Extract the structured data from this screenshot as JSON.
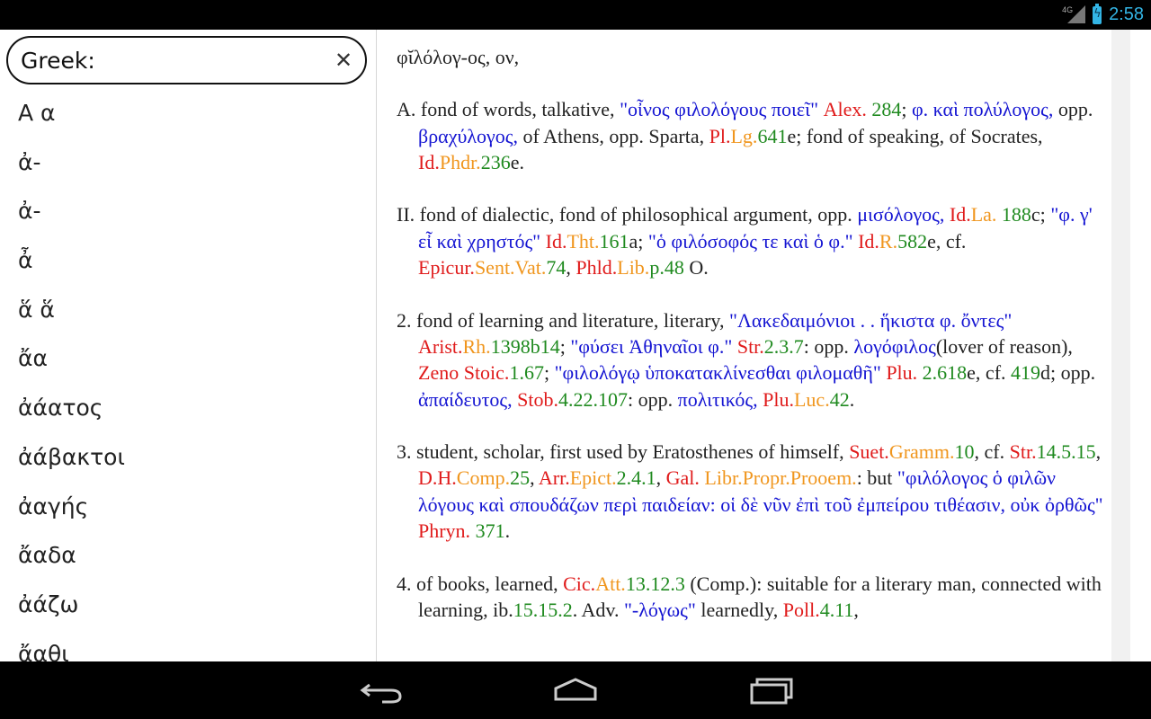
{
  "status": {
    "network": "4G",
    "time": "2:58"
  },
  "search": {
    "value": "Greek:",
    "placeholder": "Greek:"
  },
  "words": [
    "Α α",
    "ἀ-",
    "ἀ-",
    "ἆ",
    "ἅ ἅ",
    "ἄα",
    "ἀάατος",
    "ἀάβακτοι",
    "ἀαγής",
    "ἄαδα",
    "ἀάζω",
    "ἄαθι"
  ],
  "entry": {
    "title": "φῐλόλογ-ος, ον,",
    "senses": [
      {
        "label": "A.",
        "parts": [
          {
            "t": " fond of words, talkative, ",
            "c": ""
          },
          {
            "t": "\"οἶνος φιλολόγους ποιεῖ\"",
            "c": "gk"
          },
          {
            "t": " ",
            "c": ""
          },
          {
            "t": "Alex.",
            "c": "ref-a"
          },
          {
            "t": " ",
            "c": ""
          },
          {
            "t": "284",
            "c": "ref-c"
          },
          {
            "t": "; ",
            "c": ""
          },
          {
            "t": "φ. καὶ πολύλογος,",
            "c": "gk"
          },
          {
            "t": " opp. ",
            "c": ""
          },
          {
            "t": "βραχύλογος,",
            "c": "gk"
          },
          {
            "t": " of Athens, opp. Sparta, ",
            "c": ""
          },
          {
            "t": "Pl.",
            "c": "ref-a"
          },
          {
            "t": "Lg.",
            "c": "ref-b"
          },
          {
            "t": "641",
            "c": "ref-c"
          },
          {
            "t": "e; fond of speaking, of Socrates, ",
            "c": ""
          },
          {
            "t": "Id.",
            "c": "ref-a"
          },
          {
            "t": "Phdr.",
            "c": "ref-b"
          },
          {
            "t": "236",
            "c": "ref-c"
          },
          {
            "t": "e.",
            "c": ""
          }
        ]
      },
      {
        "label": "II.",
        "parts": [
          {
            "t": " fond of dialectic, fond of philosophical argument, opp. ",
            "c": ""
          },
          {
            "t": "μισόλογος,",
            "c": "gk"
          },
          {
            "t": " ",
            "c": ""
          },
          {
            "t": "Id.",
            "c": "ref-a"
          },
          {
            "t": "La.",
            "c": "ref-b"
          },
          {
            "t": " ",
            "c": ""
          },
          {
            "t": "188",
            "c": "ref-c"
          },
          {
            "t": "c; ",
            "c": ""
          },
          {
            "t": "\"φ. γ' εἶ καὶ χρηστός\"",
            "c": "gk"
          },
          {
            "t": " ",
            "c": ""
          },
          {
            "t": "Id.",
            "c": "ref-a"
          },
          {
            "t": "Tht.",
            "c": "ref-b"
          },
          {
            "t": "161",
            "c": "ref-c"
          },
          {
            "t": "a; ",
            "c": ""
          },
          {
            "t": "\"ὁ φιλόσοφός τε καὶ ὁ φ.\"",
            "c": "gk"
          },
          {
            "t": " ",
            "c": ""
          },
          {
            "t": "Id.",
            "c": "ref-a"
          },
          {
            "t": "R.",
            "c": "ref-b"
          },
          {
            "t": "582",
            "c": "ref-c"
          },
          {
            "t": "e, cf. ",
            "c": ""
          },
          {
            "t": "Epicur.",
            "c": "ref-a"
          },
          {
            "t": "Sent.Vat.",
            "c": "ref-b"
          },
          {
            "t": "74",
            "c": "ref-c"
          },
          {
            "t": ", ",
            "c": ""
          },
          {
            "t": "Phld.",
            "c": "ref-a"
          },
          {
            "t": "Lib.",
            "c": "ref-b"
          },
          {
            "t": "p.48",
            "c": "ref-c"
          },
          {
            "t": " O.",
            "c": ""
          }
        ]
      },
      {
        "label": "2.",
        "parts": [
          {
            "t": " fond of learning and literature, literary, ",
            "c": ""
          },
          {
            "t": "\"Λακεδαιμόνιοι . . ἥκιστα φ. ὄντες\"",
            "c": "gk"
          },
          {
            "t": " ",
            "c": ""
          },
          {
            "t": "Arist.",
            "c": "ref-a"
          },
          {
            "t": "Rh.",
            "c": "ref-b"
          },
          {
            "t": "1398b14",
            "c": "ref-c"
          },
          {
            "t": "; ",
            "c": ""
          },
          {
            "t": "\"φύσει Ἀθηναῖοι φ.\"",
            "c": "gk"
          },
          {
            "t": " ",
            "c": ""
          },
          {
            "t": "Str.",
            "c": "ref-a"
          },
          {
            "t": "2.3.7",
            "c": "ref-c"
          },
          {
            "t": ": opp. ",
            "c": ""
          },
          {
            "t": "λογόφιλος",
            "c": "gk"
          },
          {
            "t": "(lover of reason), ",
            "c": ""
          },
          {
            "t": "Zeno Stoic.",
            "c": "ref-a"
          },
          {
            "t": "1.67",
            "c": "ref-c"
          },
          {
            "t": "; ",
            "c": ""
          },
          {
            "t": "\"φιλολόγῳ ὑποκατακλίνεσθαι φιλομαθῆ\"",
            "c": "gk"
          },
          {
            "t": " ",
            "c": ""
          },
          {
            "t": "Plu.",
            "c": "ref-a"
          },
          {
            "t": " ",
            "c": ""
          },
          {
            "t": "2.618",
            "c": "ref-c"
          },
          {
            "t": "e, cf. ",
            "c": ""
          },
          {
            "t": "419",
            "c": "ref-c"
          },
          {
            "t": "d; opp. ",
            "c": ""
          },
          {
            "t": "ἀπαίδευτος,",
            "c": "gk"
          },
          {
            "t": " ",
            "c": ""
          },
          {
            "t": "Stob.",
            "c": "ref-a"
          },
          {
            "t": "4.22.107",
            "c": "ref-c"
          },
          {
            "t": ": opp. ",
            "c": ""
          },
          {
            "t": "πολιτικός,",
            "c": "gk"
          },
          {
            "t": " ",
            "c": ""
          },
          {
            "t": "Plu.",
            "c": "ref-a"
          },
          {
            "t": "Luc.",
            "c": "ref-b"
          },
          {
            "t": "42",
            "c": "ref-c"
          },
          {
            "t": ".",
            "c": ""
          }
        ]
      },
      {
        "label": "3.",
        "parts": [
          {
            "t": " student, scholar, first used by Eratosthenes of himself, ",
            "c": ""
          },
          {
            "t": "Suet.",
            "c": "ref-a"
          },
          {
            "t": "Gramm.",
            "c": "ref-b"
          },
          {
            "t": "10",
            "c": "ref-c"
          },
          {
            "t": ", cf. ",
            "c": ""
          },
          {
            "t": "Str.",
            "c": "ref-a"
          },
          {
            "t": "14.5.15",
            "c": "ref-c"
          },
          {
            "t": ", ",
            "c": ""
          },
          {
            "t": "D.H.",
            "c": "ref-a"
          },
          {
            "t": "Comp.",
            "c": "ref-b"
          },
          {
            "t": "25",
            "c": "ref-c"
          },
          {
            "t": ", ",
            "c": ""
          },
          {
            "t": "Arr.",
            "c": "ref-a"
          },
          {
            "t": "Epict.",
            "c": "ref-b"
          },
          {
            "t": "2.4.1",
            "c": "ref-c"
          },
          {
            "t": ", ",
            "c": ""
          },
          {
            "t": "Gal.",
            "c": "ref-a"
          },
          {
            "t": " ",
            "c": ""
          },
          {
            "t": "Libr.Propr.Prooem.",
            "c": "ref-b"
          },
          {
            "t": ": but ",
            "c": ""
          },
          {
            "t": "\"φιλόλογος ὁ φιλῶν λόγους καὶ σπουδάζων περὶ παιδείαν: οἱ δὲ νῦν ἐπὶ τοῦ ἐμπείρου τιθέασιν, οὐκ ὀρθῶς\"",
            "c": "gk"
          },
          {
            "t": " ",
            "c": ""
          },
          {
            "t": "Phryn.",
            "c": "ref-a"
          },
          {
            "t": " ",
            "c": ""
          },
          {
            "t": "371",
            "c": "ref-c"
          },
          {
            "t": ".",
            "c": ""
          }
        ]
      },
      {
        "label": "4.",
        "parts": [
          {
            "t": " of books, learned, ",
            "c": ""
          },
          {
            "t": "Cic.",
            "c": "ref-a"
          },
          {
            "t": "Att.",
            "c": "ref-b"
          },
          {
            "t": "13.12.3",
            "c": "ref-c"
          },
          {
            "t": " (Comp.): suitable for a literary man, connected with learning, ib.",
            "c": ""
          },
          {
            "t": "15.15.2",
            "c": "ref-c"
          },
          {
            "t": ". Adv. ",
            "c": ""
          },
          {
            "t": "\"-λόγως\"",
            "c": "gk"
          },
          {
            "t": " learnedly, ",
            "c": ""
          },
          {
            "t": "Poll.",
            "c": "ref-a"
          },
          {
            "t": "4.11",
            "c": "ref-c"
          },
          {
            "t": ",",
            "c": ""
          }
        ]
      }
    ]
  },
  "colors": {
    "greek": "#1414d2",
    "author": "#e01b1b",
    "work": "#f0961e",
    "locus": "#1f8a1f",
    "status_accent": "#33b5e5"
  },
  "nav": {
    "back_icon": "back-icon",
    "home_icon": "home-icon",
    "recents_icon": "recents-icon"
  }
}
